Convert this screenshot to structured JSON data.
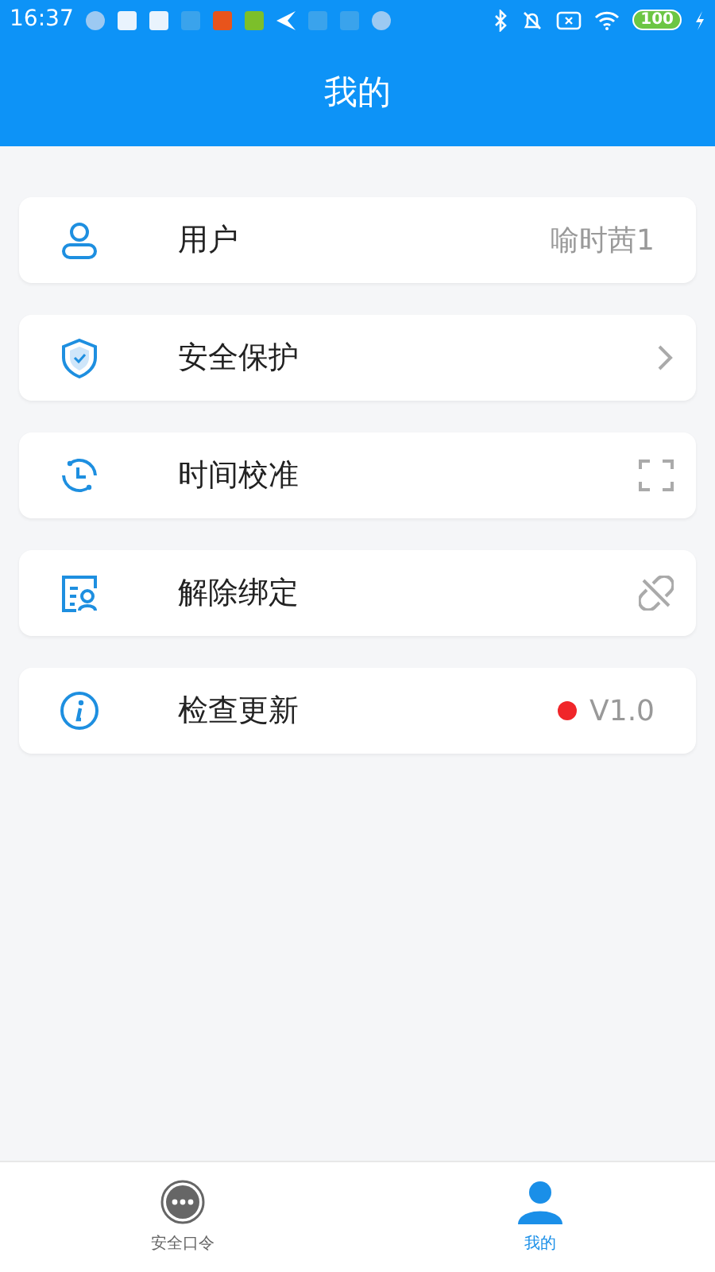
{
  "status_bar": {
    "time": "16:37",
    "battery": "100"
  },
  "header": {
    "title": "我的"
  },
  "items": [
    {
      "label": "用户",
      "kind": "value",
      "value": "喻时茜1"
    },
    {
      "label": "安全保护",
      "kind": "chevron"
    },
    {
      "label": "时间校准",
      "kind": "scan"
    },
    {
      "label": "解除绑定",
      "kind": "unlink"
    },
    {
      "label": "检查更新",
      "kind": "version",
      "value": "V1.0",
      "color": "#f0262a"
    }
  ],
  "tabs": [
    {
      "label": "安全口令",
      "selected": false
    },
    {
      "label": "我的",
      "selected": true
    }
  ]
}
